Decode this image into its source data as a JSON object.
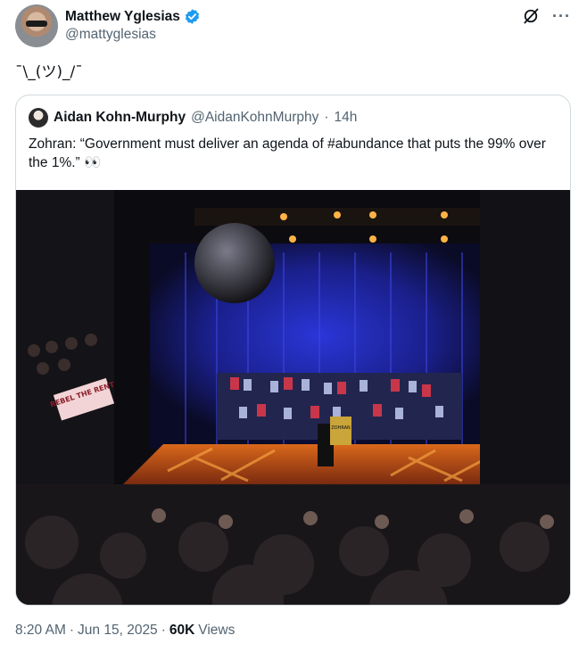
{
  "author": {
    "name": "Matthew Yglesias",
    "handle": "@mattyglesias",
    "avatar_icon": "user-avatar"
  },
  "tweet": {
    "text": "¯\\_(ツ)_/¯"
  },
  "quote": {
    "name": "Aidan Kohn-Murphy",
    "handle": "@AidanKohnMurphy",
    "separator": "·",
    "time": "14h",
    "text": "Zohran: “Government must deliver an agenda of #abundance that puts the 99% over the 1%.” 👀",
    "image_sign": "REBEL THE RENT"
  },
  "meta": {
    "time": "8:20 AM",
    "sep1": "·",
    "date": "Jun 15, 2025",
    "sep2": "·",
    "views_count": "60K",
    "views_label": "Views"
  },
  "colors": {
    "verified": "#1d9bf0",
    "muted": "#536471",
    "text": "#0f1419"
  }
}
